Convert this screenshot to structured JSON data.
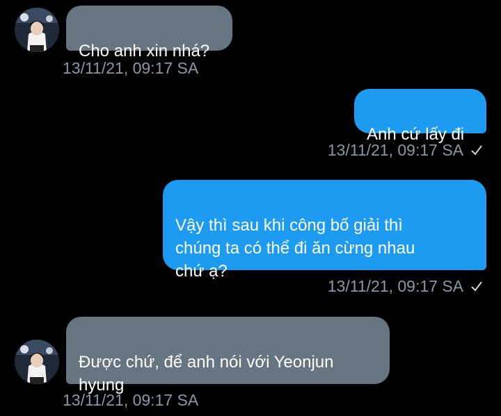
{
  "conversation": {
    "messages": [
      {
        "direction": "incoming",
        "text": "Cho anh xin nhá?",
        "timestamp": "13/11/21, 09:17 SA",
        "avatar_icon": "profile-photo"
      },
      {
        "direction": "outgoing",
        "text": "Anh cứ lấy đi",
        "timestamp": "13/11/21, 09:17 SA",
        "status_icon": "check-icon"
      },
      {
        "direction": "outgoing",
        "text": "Vậy thì sau khi công bố giải thì\nchúng ta có thể đi ăn cừng nhau\nchứ ạ?",
        "timestamp": "13/11/21, 09:17 SA",
        "status_icon": "check-icon"
      },
      {
        "direction": "incoming",
        "text": "Được chứ, để anh nói với Yeonjun\nhyung",
        "timestamp": "13/11/21, 09:17 SA",
        "avatar_icon": "profile-photo"
      }
    ]
  },
  "colors": {
    "background": "#000000",
    "incoming_bubble": "#66757f",
    "outgoing_bubble": "#1d9bf0",
    "timestamp": "#8b98a5",
    "bubble_text": "#ffffff"
  }
}
